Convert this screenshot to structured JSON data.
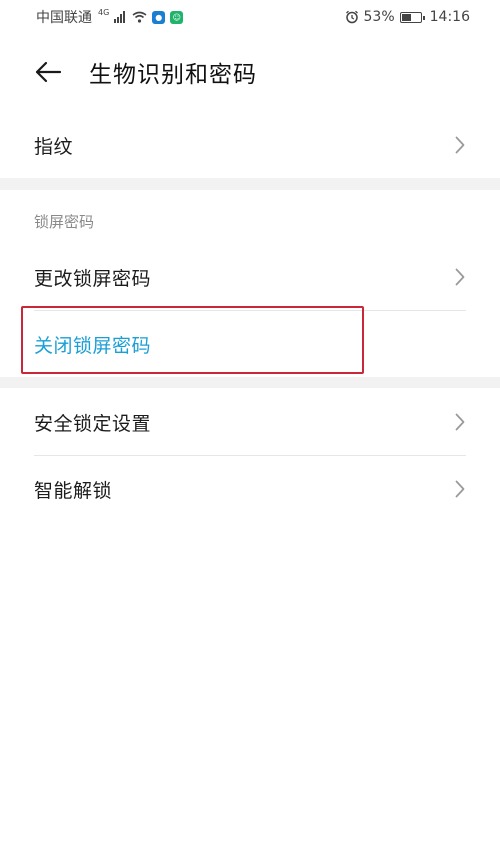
{
  "status_bar": {
    "carrier": "中国联通",
    "network": "4G",
    "battery_percent": "53%",
    "time": "14:16"
  },
  "header": {
    "title": "生物识别和密码"
  },
  "items": {
    "fingerprint": "指纹",
    "section_lockscreen": "锁屏密码",
    "change_password": "更改锁屏密码",
    "disable_password": "关闭锁屏密码",
    "security_lock": "安全锁定设置",
    "smart_unlock": "智能解锁"
  },
  "colors": {
    "accent": "#1a9fd6",
    "highlight_border": "#c8283a",
    "section_gap": "#f2f2f2"
  }
}
